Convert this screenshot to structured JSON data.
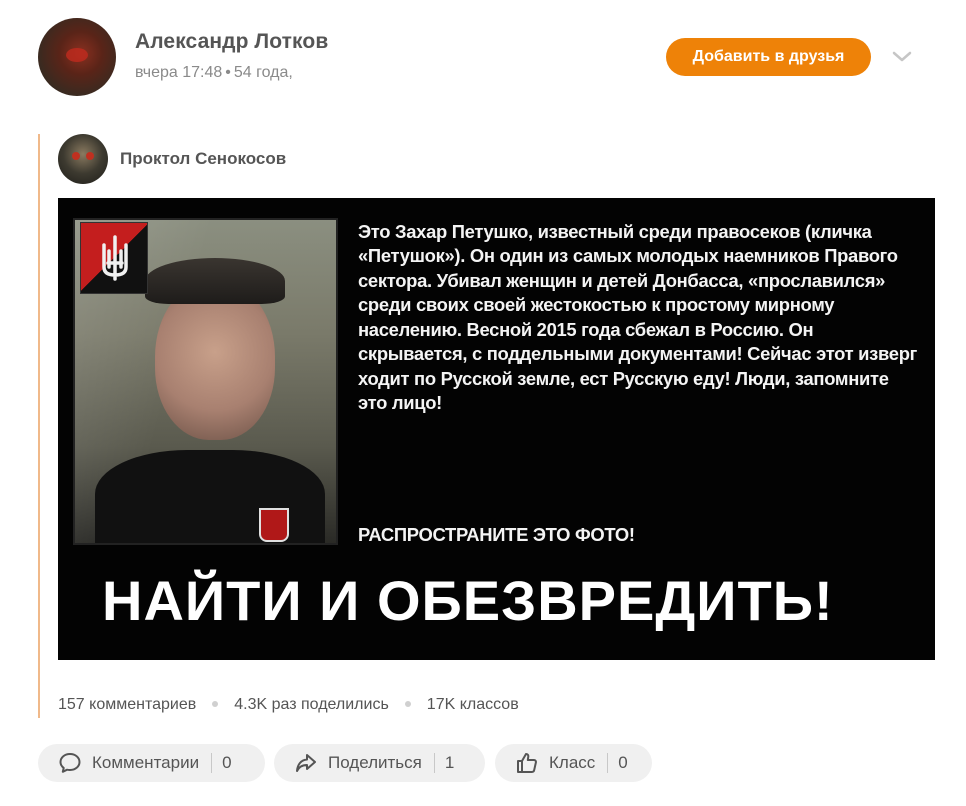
{
  "author": {
    "name": "Александр Лотков",
    "time": "вчера 17:48",
    "age": "54 года,"
  },
  "header": {
    "add_friend_label": "Добавить в друзья"
  },
  "repost": {
    "original_author": "Проктол Сенокосов"
  },
  "image": {
    "text": "Это Захар Петушко, известный среди правосеков (кличка «Петушок»). Он один из самых молодых наемников Правого сектора.  Убивал женщин и детей Донбасса, «прославился» среди своих своей жестокостью к простому мирному населению. Весной 2015 года сбежал в Россию. Он скрывается, с поддельными документами! Сейчас этот изверг ходит по Русской земле, ест Русскую еду!  Люди, запомните это лицо!",
    "cta": "РАСПРОСТРАНИТЕ ЭТО ФОТО!",
    "headline": "НАЙТИ И ОБЕЗВРЕДИТЬ!"
  },
  "stats": {
    "comments": "157 комментариев",
    "shares": "4.3K раз поделились",
    "likes": "17K классов"
  },
  "actions": {
    "comment_label": "Комментарии",
    "comment_count": "0",
    "share_label": "Поделиться",
    "share_count": "1",
    "like_label": "Класс",
    "like_count": "0"
  },
  "colors": {
    "accent": "#ee8208",
    "repost_line": "#f0b98a",
    "button_bg": "#f0f0f0"
  },
  "icons": {
    "comment": "speech-bubble-icon",
    "share": "share-arrow-icon",
    "like": "thumbs-up-icon",
    "more": "chevron-down-icon"
  }
}
